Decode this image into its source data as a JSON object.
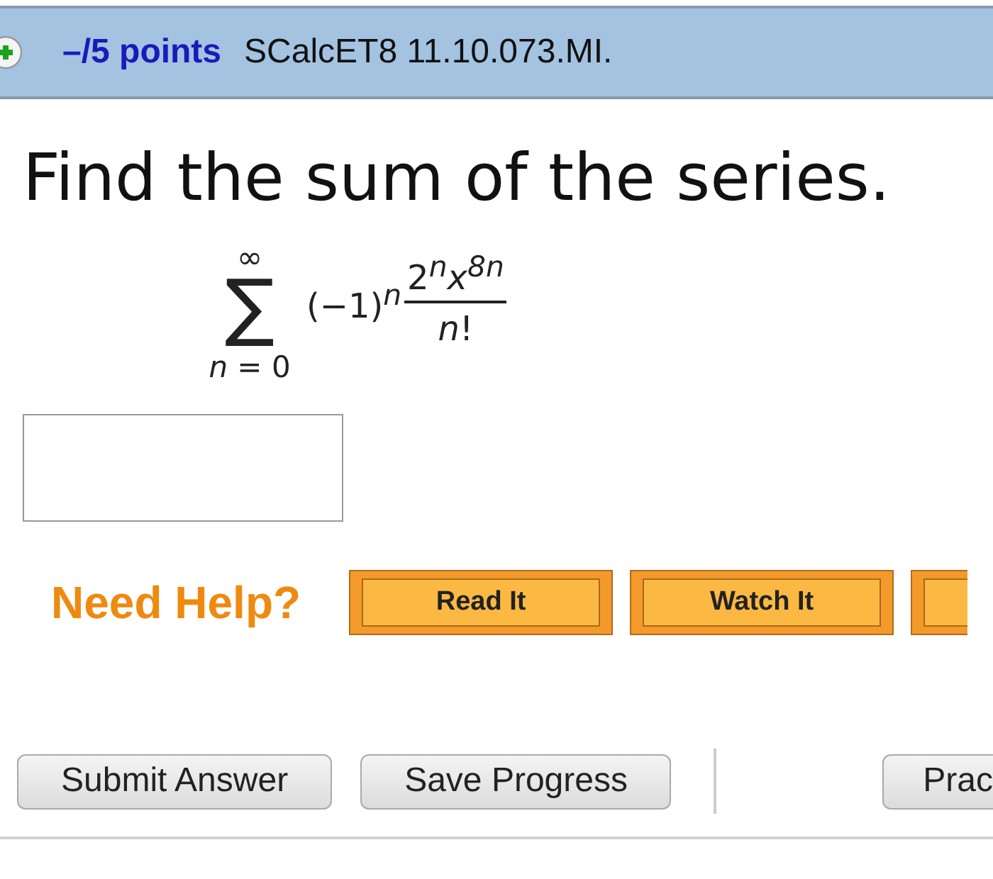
{
  "header": {
    "points": "–/5 points",
    "problem_id": "SCalcET8 11.10.073.MI."
  },
  "question": "Find the sum of the series.",
  "series": {
    "sigma": "∑",
    "upper": "∞",
    "lower": "*n* = 0",
    "factor": "(−1)$^{n}$",
    "numerator": "2$^{n}$*x*$^{8n}$",
    "denominator": "*n*!"
  },
  "help": {
    "label": "Need Help?",
    "buttons": [
      {
        "kind": "full",
        "label": "Read It"
      },
      {
        "kind": "full",
        "label": "Watch It"
      },
      {
        "kind": "cut"
      }
    ]
  },
  "actions": [
    {
      "kind": "button",
      "label": "Submit Answer"
    },
    {
      "kind": "button",
      "label": "Save Progress"
    },
    {
      "kind": "divider"
    },
    {
      "kind": "cut",
      "label": "Prac"
    }
  ]
}
